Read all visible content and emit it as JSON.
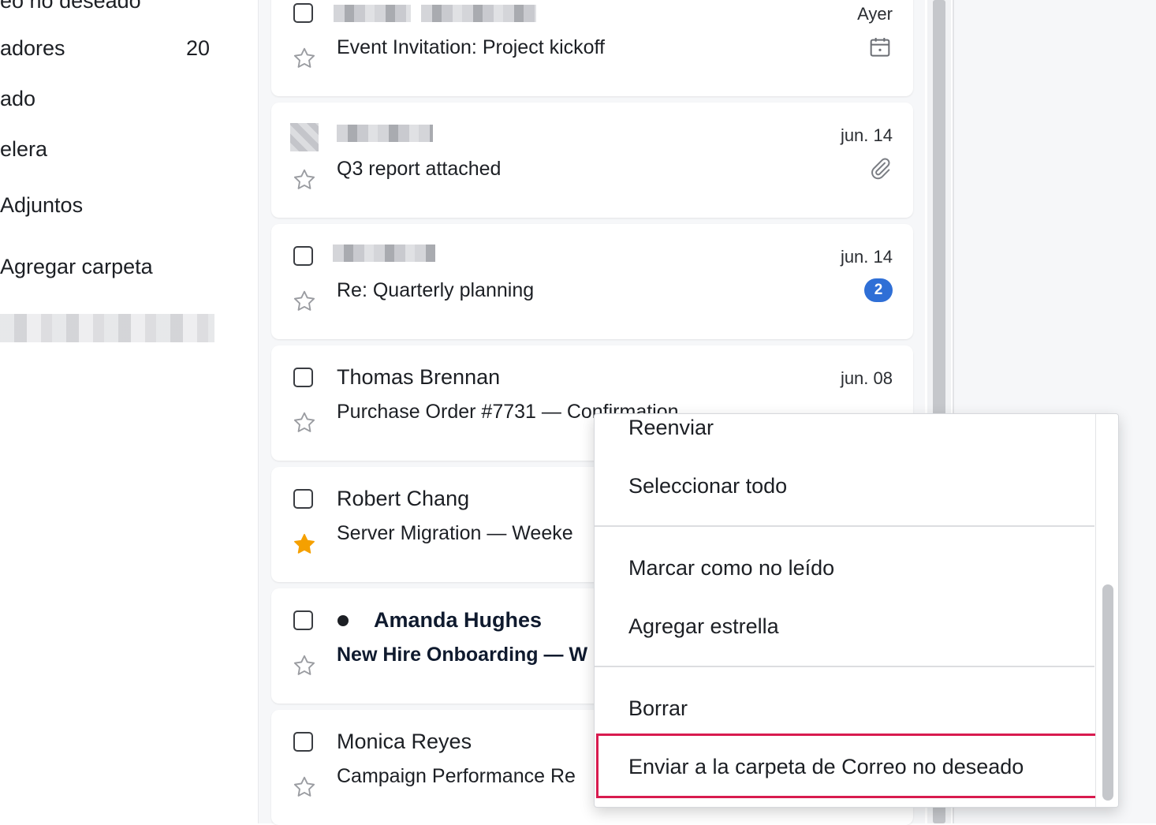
{
  "sidebar": {
    "items": [
      {
        "label": "eo no deseado"
      },
      {
        "label": "adores",
        "count": "20"
      },
      {
        "label": "ado"
      },
      {
        "label": "elera"
      },
      {
        "label": "Adjuntos"
      },
      {
        "label": "Agregar carpeta"
      }
    ]
  },
  "emails": [
    {
      "sender": "",
      "subject": "Event Invitation: Project kickoff",
      "date": "Ayer",
      "starred": false,
      "unread": false,
      "icon": "calendar-icon"
    },
    {
      "sender": "",
      "subject": "Q3 report attached",
      "date": "jun. 14",
      "starred": false,
      "unread": false,
      "icon": "paperclip-icon"
    },
    {
      "sender": "",
      "subject": "Re: Quarterly planning",
      "date": "jun. 14",
      "starred": false,
      "unread": false,
      "badge": "2"
    },
    {
      "sender": "Thomas Brennan",
      "subject": "Purchase Order #7731 — Confirmation",
      "date": "jun. 08",
      "starred": false,
      "unread": false
    },
    {
      "sender": "Robert Chang",
      "subject": "Server Migration — Weeke",
      "date": "",
      "starred": true,
      "unread": false
    },
    {
      "sender": "Amanda Hughes",
      "subject": "New Hire Onboarding — W",
      "date": "",
      "starred": false,
      "unread": true
    },
    {
      "sender": "Monica Reyes",
      "subject": "Campaign Performance Re",
      "date": "",
      "starred": false,
      "unread": false
    }
  ],
  "context_menu": {
    "items": [
      {
        "label": "Reenviar"
      },
      {
        "label": "Seleccionar todo"
      },
      {
        "label": "Marcar como no leído"
      },
      {
        "label": "Agregar estrella"
      },
      {
        "label": "Borrar"
      },
      {
        "label": "Enviar a la carpeta de Correo no deseado",
        "highlighted": true
      }
    ]
  },
  "colors": {
    "accent": "#2f6fd6",
    "highlight": "#d81b4f",
    "star_filled": "#f5a000"
  }
}
